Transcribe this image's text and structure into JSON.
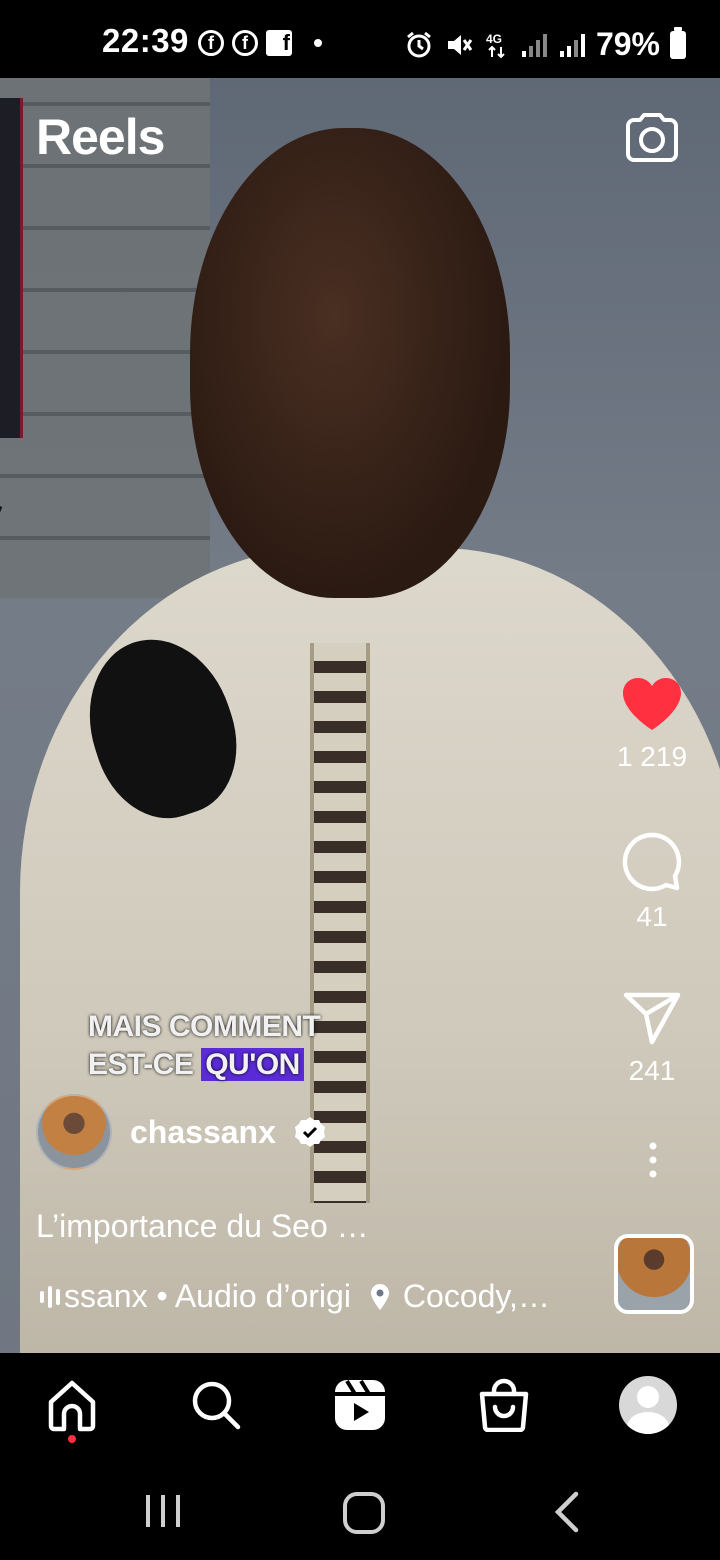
{
  "status_bar": {
    "time": "22:39",
    "left_icons": [
      "facebook-icon",
      "facebook-icon",
      "facebook-pages-icon",
      "dot"
    ],
    "right_icons": [
      "alarm-icon",
      "mute-icon",
      "4g-icon",
      "signal-icon",
      "signal-icon"
    ],
    "network": "4G",
    "battery": "79%"
  },
  "header": {
    "title": "Reels",
    "camera_icon": "camera-icon"
  },
  "video": {
    "overlay_text_line1": "MAIS COMMENT",
    "overlay_text_line2_a": "EST-CE",
    "overlay_text_line2_b": "QU'ON"
  },
  "actions": {
    "likes": "1 219",
    "comments": "41",
    "shares": "241",
    "like_color": "#ff3040"
  },
  "post": {
    "username": "chassanx",
    "verified": true,
    "caption": "L’importance du Seo …",
    "audio_text": "ssanx • Audio d’origi",
    "location": "Cocody,…"
  },
  "bottom_nav": {
    "items": [
      "home-icon",
      "search-icon",
      "reels-icon",
      "shop-icon",
      "profile-avatar"
    ],
    "active": "home-icon"
  },
  "system_nav": [
    "recents-button",
    "home-button",
    "back-button"
  ]
}
